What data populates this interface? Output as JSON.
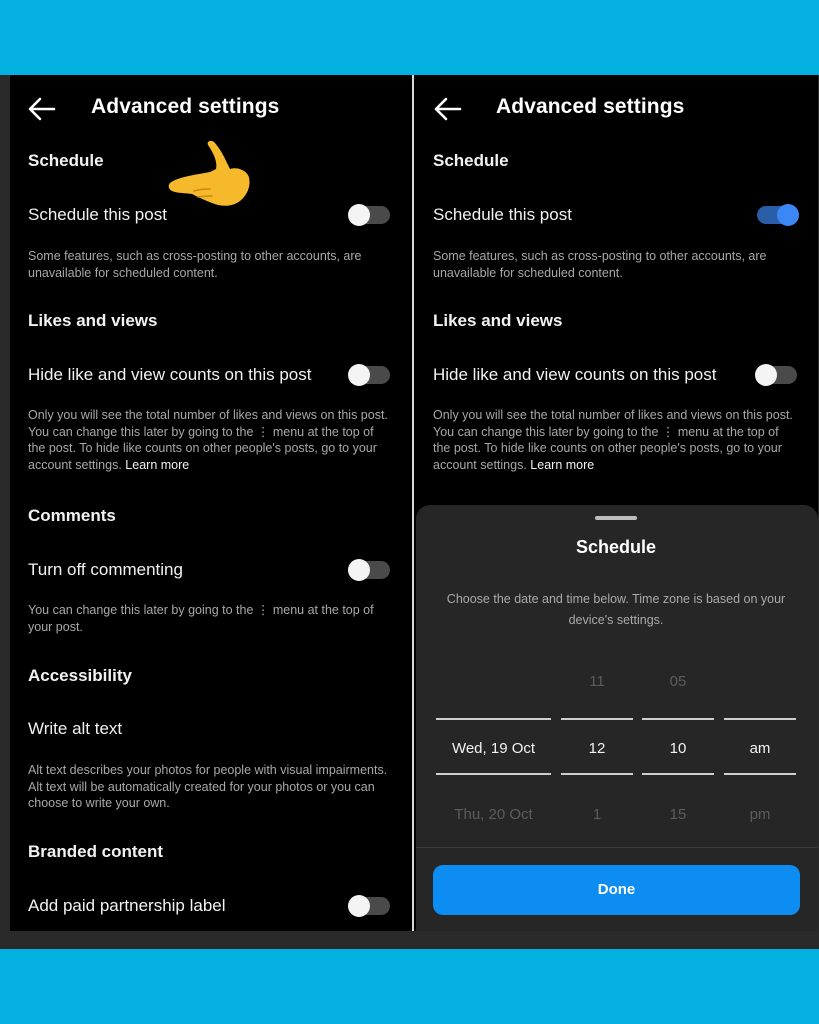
{
  "left": {
    "header": {
      "title": "Advanced settings"
    },
    "schedule": {
      "heading": "Schedule",
      "toggle_label": "Schedule this post",
      "description": "Some features, such as cross-posting to other accounts, are unavailable for scheduled content.",
      "toggle_on": false
    },
    "likes": {
      "heading": "Likes and views",
      "toggle_label": "Hide like and view counts on this post",
      "description": "Only you will see the total number of likes and views on this post. You can change this later by going to the ⋮ menu at the top of the post. To hide like counts on other people's posts, go to your account settings.",
      "learn_more": "Learn more",
      "toggle_on": false
    },
    "comments": {
      "heading": "Comments",
      "toggle_label": "Turn off commenting",
      "description": "You can change this later by going to the ⋮ menu at the top of your post.",
      "toggle_on": false
    },
    "accessibility": {
      "heading": "Accessibility",
      "row_label": "Write alt text",
      "description": "Alt text describes your photos for people with visual impairments. Alt text will be automatically created for your photos or you can choose to write your own."
    },
    "branded": {
      "heading": "Branded content",
      "toggle_label": "Add paid partnership label",
      "toggle_on": false
    }
  },
  "right": {
    "header": {
      "title": "Advanced settings"
    },
    "schedule": {
      "heading": "Schedule",
      "toggle_label": "Schedule this post",
      "description": "Some features, such as cross-posting to other accounts, are unavailable for scheduled content.",
      "toggle_on": true
    },
    "likes": {
      "heading": "Likes and views",
      "toggle_label": "Hide like and view counts on this post",
      "description": "Only you will see the total number of likes and views on this post. You can change this later by going to the ⋮ menu at the top of the post. To hide like counts on other people's posts, go to your account settings.",
      "learn_more": "Learn more",
      "toggle_on": false
    },
    "sheet": {
      "title": "Schedule",
      "description": "Choose the date and time below. Time zone is based on your device's settings.",
      "picker": {
        "date": {
          "selected": "Wed, 19 Oct",
          "next": "Thu, 20 Oct"
        },
        "hour": {
          "prev": "11",
          "selected": "12",
          "next": "1"
        },
        "minute": {
          "prev": "05",
          "selected": "10",
          "next": "15"
        },
        "ampm": {
          "selected": "am",
          "next": "pm"
        }
      },
      "done_label": "Done"
    }
  },
  "icons": {
    "back": "arrow-left-icon",
    "pointer": "hand-pointing-left-emoji"
  },
  "colors": {
    "background": "#03b0e0",
    "accent": "#0d8cf2",
    "toggle_on": "#3b87f5"
  }
}
